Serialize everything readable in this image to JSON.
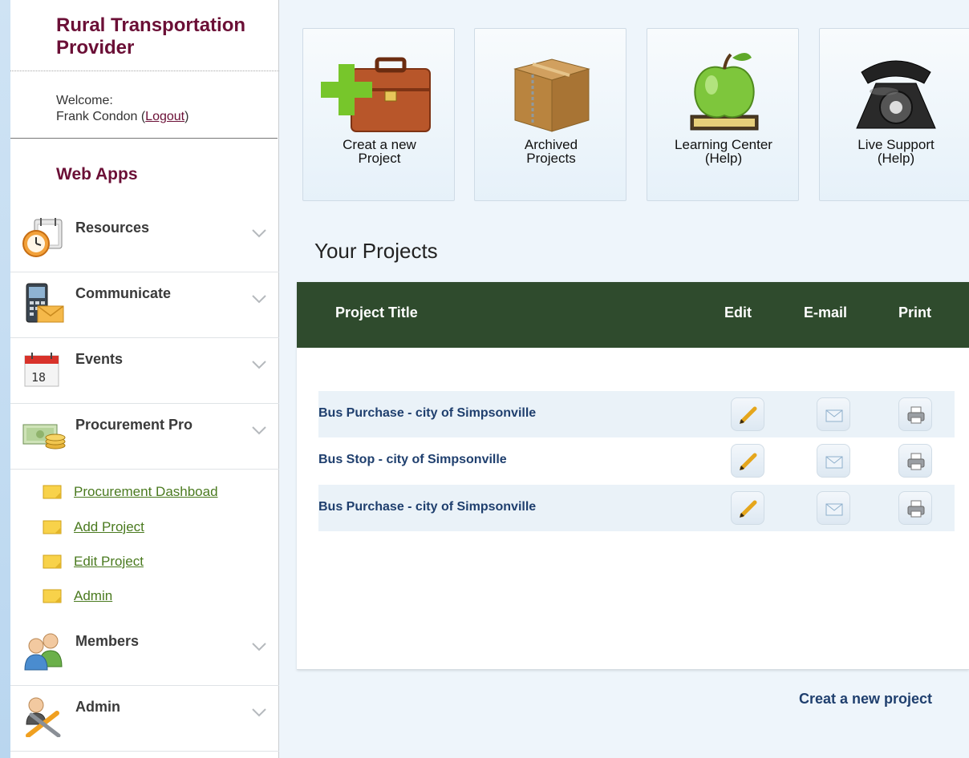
{
  "sidebar": {
    "brand": "Rural Transportation Provider",
    "welcome_label": "Welcome:",
    "user_name": "Frank Condon (",
    "logout": "Logout",
    "close_paren": ")",
    "section_title": "Web Apps",
    "nav": [
      {
        "label": "Resources",
        "icon": "alarm-clock-icon"
      },
      {
        "label": "Communicate",
        "icon": "phone-mail-icon"
      },
      {
        "label": "Events",
        "icon": "calendar-icon"
      },
      {
        "label": "Procurement Pro",
        "icon": "money-coins-icon"
      },
      {
        "label": "Members",
        "icon": "users-icon"
      },
      {
        "label": "Admin",
        "icon": "admin-tools-icon"
      }
    ],
    "calendar_day": "18",
    "subnav": [
      {
        "label": "Procurement Dashboad"
      },
      {
        "label": "Add Project"
      },
      {
        "label": "Edit Project"
      },
      {
        "label": "Admin"
      }
    ]
  },
  "tiles": [
    {
      "label": "Creat a new\nProject",
      "icon": "briefcase-plus-icon"
    },
    {
      "label": "Archived\nProjects",
      "icon": "box-icon"
    },
    {
      "label": "Learning Center\n(Help)",
      "icon": "apple-icon"
    },
    {
      "label": "Live Support\n(Help)",
      "icon": "telephone-icon"
    }
  ],
  "projects": {
    "title": "Your Projects",
    "columns": {
      "title": "Project Title",
      "edit": "Edit",
      "email": "E-mail",
      "print": "Print"
    },
    "rows": [
      {
        "title": "Bus Purchase - city of Simpsonville"
      },
      {
        "title": "Bus Stop - city of Simpsonville"
      },
      {
        "title": "Bus Purchase - city of Simpsonville"
      }
    ],
    "create_link": "Creat a new project"
  },
  "colors": {
    "brand": "#6b0f36",
    "header": "#2f4b2d",
    "link": "#1f3f6e",
    "sublink": "#4a7a1f"
  }
}
